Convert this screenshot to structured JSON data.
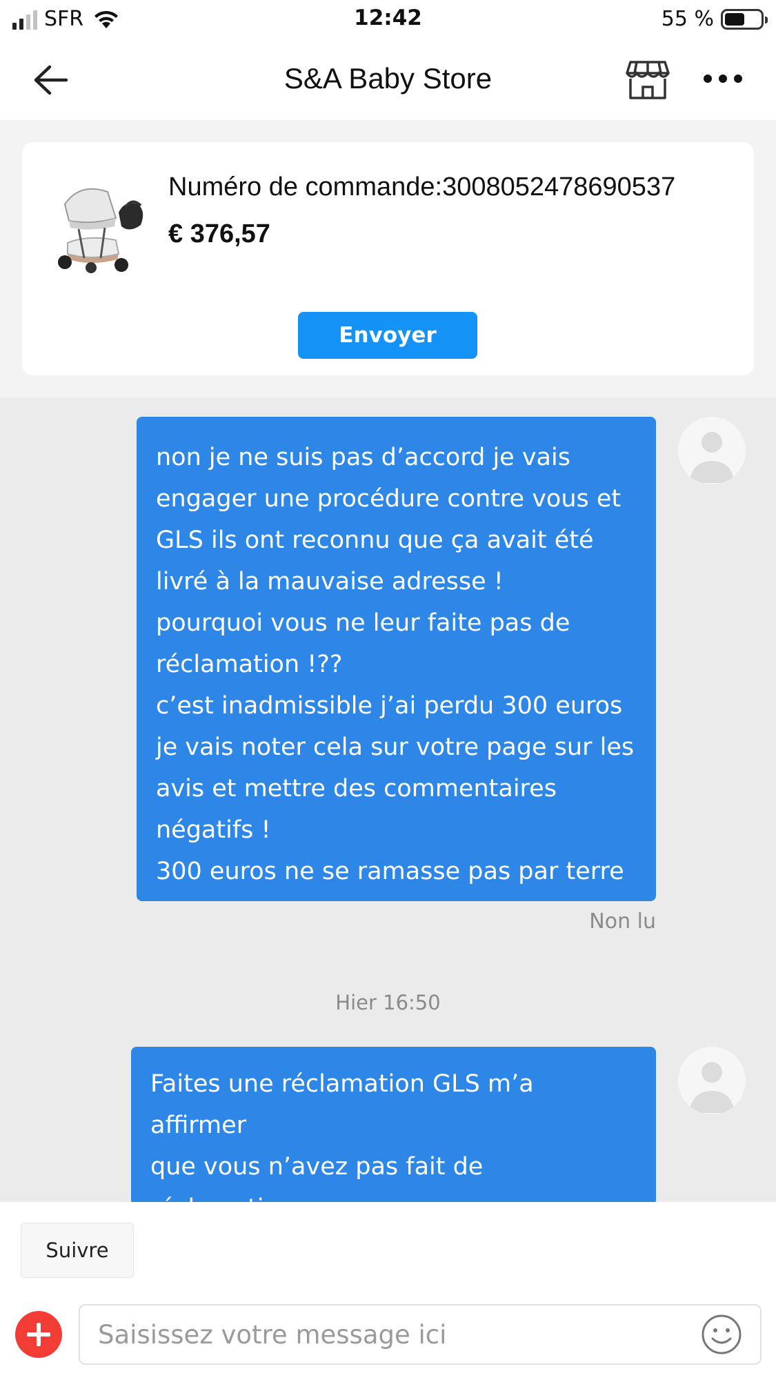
{
  "status_bar": {
    "carrier": "SFR",
    "time": "12:42",
    "battery_percent": "55 %",
    "battery_level": 0.55,
    "signal_bars_active": 2
  },
  "header": {
    "title": "S&A Baby Store",
    "back_icon": "arrow-left-icon",
    "store_icon": "store-icon",
    "more_icon": "more-horizontal-icon"
  },
  "order_card": {
    "order_number": "Numéro de commande:3008052478690537",
    "price": "€ 376,57",
    "send_label": "Envoyer",
    "accent_color": "#1592f5"
  },
  "messages": [
    {
      "text": "non je ne suis pas d’accord je vais\nengager une procédure contre vous et\nGLS ils ont reconnu que ça avait été\nlivré à la mauvaise adresse !\npourquoi vous ne leur faite pas de\nréclamation !??\nc’est inadmissible j’ai perdu 300 euros\nje vais noter cela sur votre page sur les\navis et mettre des commentaires\nnégatifs !\n300 euros ne se ramasse pas par terre",
      "status": "Non lu"
    },
    {
      "text": "Faites une réclamation GLS m’a affirmer\nque vous n’avez pas fait de réclamation.\nJe vais utilisé ma protection juridique."
    }
  ],
  "timestamp": "Hier 16:50",
  "bubble_color": "#2e87e6",
  "bottom": {
    "follow_label": "Suivre",
    "input_placeholder": "Saisissez votre message ici",
    "plus_icon": "plus-circle-icon",
    "emoji_icon": "smiley-icon",
    "plus_color": "#f23d36"
  }
}
